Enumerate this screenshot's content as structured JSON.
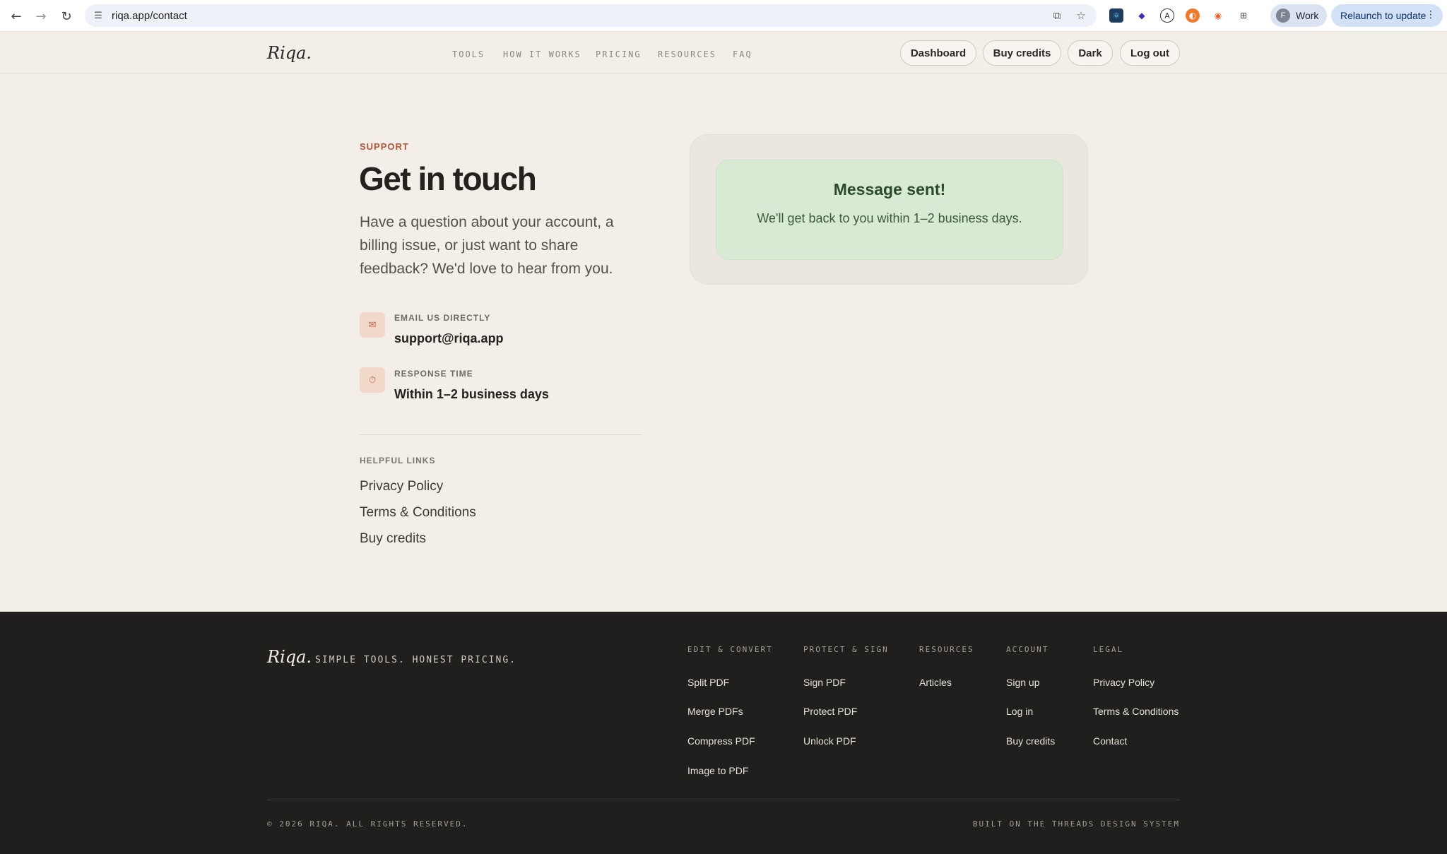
{
  "browser": {
    "url": "riqa.app/contact",
    "profile_initial": "F",
    "profile_name": "Work",
    "relaunch_label": "Relaunch to update"
  },
  "site": {
    "logo": "Riqa.",
    "nav": [
      "TOOLS",
      "HOW IT WORKS",
      "PRICING",
      "RESOURCES",
      "FAQ"
    ],
    "actions": {
      "dashboard": "Dashboard",
      "buy_credits": "Buy credits",
      "dark": "Dark",
      "log_out": "Log out"
    }
  },
  "contact": {
    "eyebrow": "SUPPORT",
    "title": "Get in touch",
    "lead": "Have a question about your account, a billing issue, or just want to share feedback? We'd love to hear from you.",
    "email_label": "EMAIL US DIRECTLY",
    "email_value": "support@riqa.app",
    "response_label": "RESPONSE TIME",
    "response_value": "Within 1–2 business days",
    "helpful_heading": "HELPFUL LINKS",
    "helpful_links": [
      "Privacy Policy",
      "Terms & Conditions",
      "Buy credits"
    ]
  },
  "success": {
    "title": "Message sent!",
    "text": "We'll get back to you within 1–2 business days."
  },
  "footer": {
    "logo": "Riqa.",
    "tagline": "SIMPLE TOOLS. HONEST PRICING.",
    "columns": [
      {
        "heading": "EDIT & CONVERT",
        "links": [
          "Split PDF",
          "Merge PDFs",
          "Compress PDF",
          "Image to PDF"
        ]
      },
      {
        "heading": "PROTECT & SIGN",
        "links": [
          "Sign PDF",
          "Protect PDF",
          "Unlock PDF"
        ]
      },
      {
        "heading": "RESOURCES",
        "links": [
          "Articles"
        ]
      },
      {
        "heading": "ACCOUNT",
        "links": [
          "Sign up",
          "Log in",
          "Buy credits"
        ]
      },
      {
        "heading": "LEGAL",
        "links": [
          "Privacy Policy",
          "Terms & Conditions",
          "Contact"
        ]
      }
    ],
    "copyright": "© 2026 RIQA. ALL RIGHTS RESERVED.",
    "built_on": "BUILT ON THE THREADS DESIGN SYSTEM"
  },
  "colors": {
    "background": "#f3efe8",
    "accent": "#b0553a",
    "success_bg": "#d9ead4",
    "footer_bg": "#201f1d"
  }
}
